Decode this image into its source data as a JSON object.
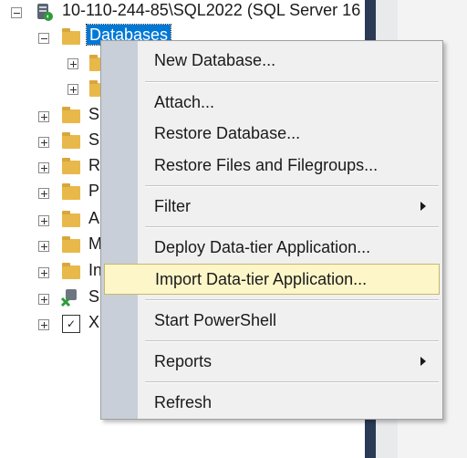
{
  "tree": {
    "server_label": "10-110-244-85\\SQL2022 (SQL Server 16",
    "databases_label": "Databases",
    "partial_labels": [
      "S",
      "S",
      "R",
      "P",
      "A",
      "M",
      "In",
      "S",
      "X"
    ]
  },
  "menu": {
    "items": [
      {
        "label": "New Database..."
      },
      {
        "label": "Attach..."
      },
      {
        "label": "Restore Database..."
      },
      {
        "label": "Restore Files and Filegroups..."
      },
      {
        "label": "Filter"
      },
      {
        "label": "Deploy Data-tier Application..."
      },
      {
        "label": "Import Data-tier Application..."
      },
      {
        "label": "Start PowerShell"
      },
      {
        "label": "Reports"
      },
      {
        "label": "Refresh"
      }
    ],
    "highlighted": "Import Data-tier Application..."
  },
  "colors": {
    "selection": "#0078d7",
    "menu_background": "#f0f0f0",
    "menu_gutter": "#c9cfd9",
    "highlight_background": "#fcf6c8",
    "folder": "#e8b84a"
  }
}
